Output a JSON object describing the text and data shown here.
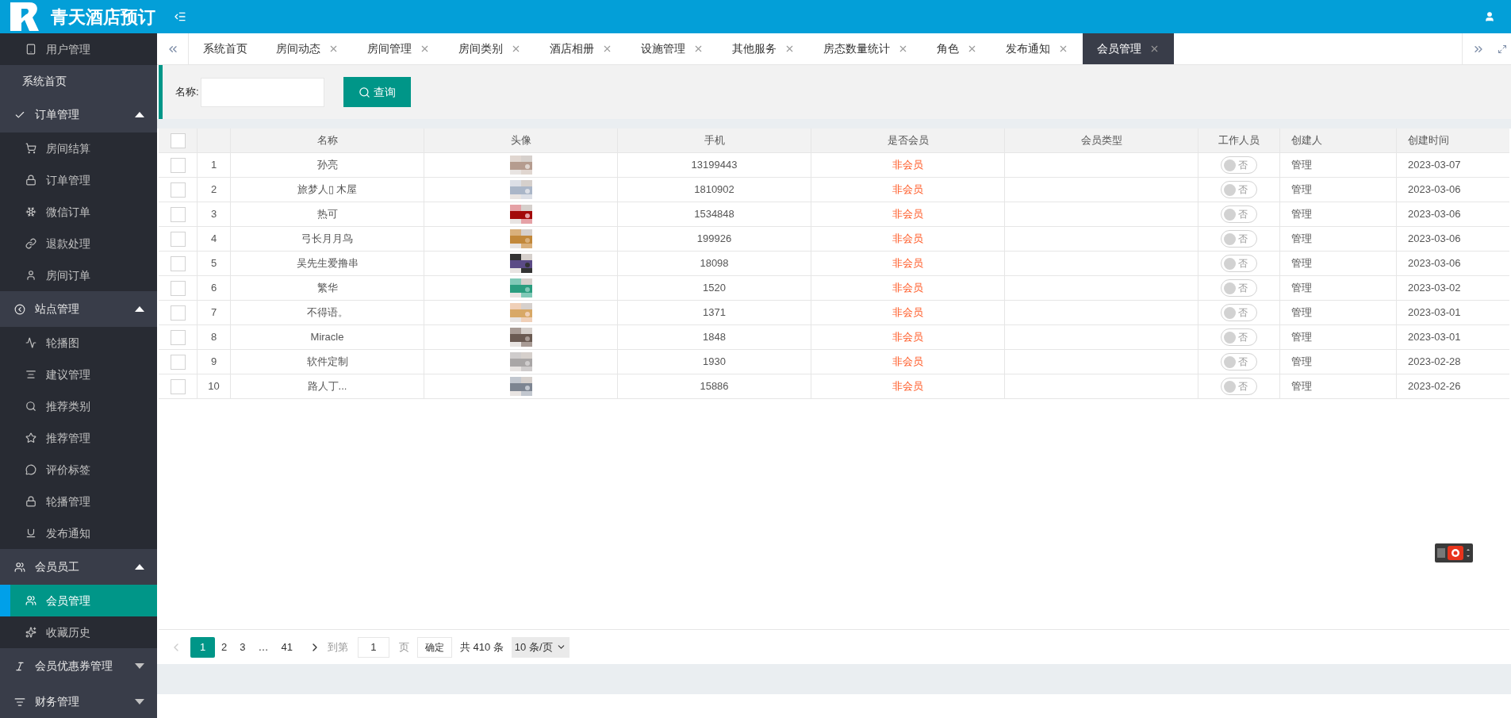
{
  "header": {
    "title": "青天酒店预订"
  },
  "sidebar": {
    "items": [
      {
        "label": "用户管理",
        "kind": "sub",
        "selected": false
      },
      {
        "label": "系统首页",
        "kind": "plain",
        "selected": false
      },
      {
        "label": "订单管理",
        "kind": "group",
        "expanded": true,
        "children": [
          {
            "label": "房间结算",
            "selected": false
          },
          {
            "label": "订单管理",
            "selected": false
          },
          {
            "label": "微信订单",
            "selected": false
          },
          {
            "label": "退款处理",
            "selected": false
          },
          {
            "label": "房间订单",
            "selected": false
          }
        ]
      },
      {
        "label": "站点管理",
        "kind": "group",
        "expanded": true,
        "children": [
          {
            "label": "轮播图",
            "selected": false
          },
          {
            "label": "建议管理",
            "selected": false
          },
          {
            "label": "推荐类别",
            "selected": false
          },
          {
            "label": "推荐管理",
            "selected": false
          },
          {
            "label": "评价标签",
            "selected": false
          },
          {
            "label": "轮播管理",
            "selected": false
          },
          {
            "label": "发布通知",
            "selected": false
          }
        ]
      },
      {
        "label": "会员员工",
        "kind": "group",
        "expanded": true,
        "children": [
          {
            "label": "会员管理",
            "selected": true
          },
          {
            "label": "收藏历史",
            "selected": false
          }
        ]
      },
      {
        "label": "会员优惠券管理",
        "kind": "group",
        "expanded": false
      },
      {
        "label": "财务管理",
        "kind": "group",
        "expanded": false
      }
    ]
  },
  "tabs": [
    {
      "label": "系统首页",
      "selected": false,
      "closable": false
    },
    {
      "label": "房间动态",
      "selected": false,
      "closable": true
    },
    {
      "label": "房间管理",
      "selected": false,
      "closable": true
    },
    {
      "label": "房间类别",
      "selected": false,
      "closable": true
    },
    {
      "label": "酒店相册",
      "selected": false,
      "closable": true
    },
    {
      "label": "设施管理",
      "selected": false,
      "closable": true
    },
    {
      "label": "其他服务",
      "selected": false,
      "closable": true
    },
    {
      "label": "房态数量统计",
      "selected": false,
      "closable": true
    },
    {
      "label": "角色",
      "selected": false,
      "closable": true
    },
    {
      "label": "发布通知",
      "selected": false,
      "closable": true
    },
    {
      "label": "会员管理",
      "selected": true,
      "closable": true
    }
  ],
  "search": {
    "label": "名称:",
    "button": "查询"
  },
  "table": {
    "columns": [
      "名称",
      "头像",
      "手机",
      "是否会员",
      "会员类型",
      "工作人员",
      "创建人",
      "创建时间"
    ],
    "header_checked": false,
    "rows": [
      {
        "index": "1",
        "name": "孙亮",
        "phone": "13199443",
        "member": "非会员",
        "staff": {
          "on": false,
          "label": "否"
        },
        "creator": "管理",
        "created": "2023-03-07",
        "checked": false
      },
      {
        "index": "2",
        "name": "旅梦人▯ 木屋",
        "phone": "1810902",
        "member": "非会员",
        "staff": {
          "on": false,
          "label": "否"
        },
        "creator": "管理",
        "created": "2023-03-06",
        "checked": false
      },
      {
        "index": "3",
        "name": "热可",
        "phone": "1534848",
        "member": "非会员",
        "staff": {
          "on": false,
          "label": "否"
        },
        "creator": "管理",
        "created": "2023-03-06",
        "checked": false
      },
      {
        "index": "4",
        "name": "弓长月月鸟",
        "phone": "199926",
        "member": "非会员",
        "staff": {
          "on": false,
          "label": "否"
        },
        "creator": "管理",
        "created": "2023-03-06",
        "checked": false
      },
      {
        "index": "5",
        "name": "吴先生爱撸串",
        "phone": "18098",
        "member": "非会员",
        "staff": {
          "on": false,
          "label": "否"
        },
        "creator": "管理",
        "created": "2023-03-06",
        "checked": false
      },
      {
        "index": "6",
        "name": "繁华",
        "phone": "1520",
        "member": "非会员",
        "staff": {
          "on": false,
          "label": "否"
        },
        "creator": "管理",
        "created": "2023-03-02",
        "checked": false
      },
      {
        "index": "7",
        "name": "不得语。",
        "phone": "1371",
        "member": "非会员",
        "staff": {
          "on": false,
          "label": "否"
        },
        "creator": "管理",
        "created": "2023-03-01",
        "checked": false
      },
      {
        "index": "8",
        "name": "Miracle",
        "phone": "1848",
        "member": "非会员",
        "staff": {
          "on": false,
          "label": "否"
        },
        "creator": "管理",
        "created": "2023-03-01",
        "checked": false
      },
      {
        "index": "9",
        "name": "软件定制",
        "phone": "1930",
        "member": "非会员",
        "staff": {
          "on": false,
          "label": "否"
        },
        "creator": "管理",
        "created": "2023-02-28",
        "checked": false
      },
      {
        "index": "10",
        "name": "路人丁...",
        "phone": "15886",
        "member": "非会员",
        "staff": {
          "on": false,
          "label": "否"
        },
        "creator": "管理",
        "created": "2023-02-26",
        "checked": false
      }
    ]
  },
  "pagination": {
    "pages": [
      {
        "label": "1",
        "selected": true
      },
      {
        "label": "2",
        "selected": false
      },
      {
        "label": "3",
        "selected": false
      },
      {
        "label": "…",
        "selected": false
      },
      {
        "label": "41",
        "selected": false
      }
    ],
    "goto_label": "到第",
    "goto_value": "1",
    "page_unit": "页",
    "confirm": "确定",
    "total": "共 410 条",
    "page_size": "10 条/页"
  }
}
